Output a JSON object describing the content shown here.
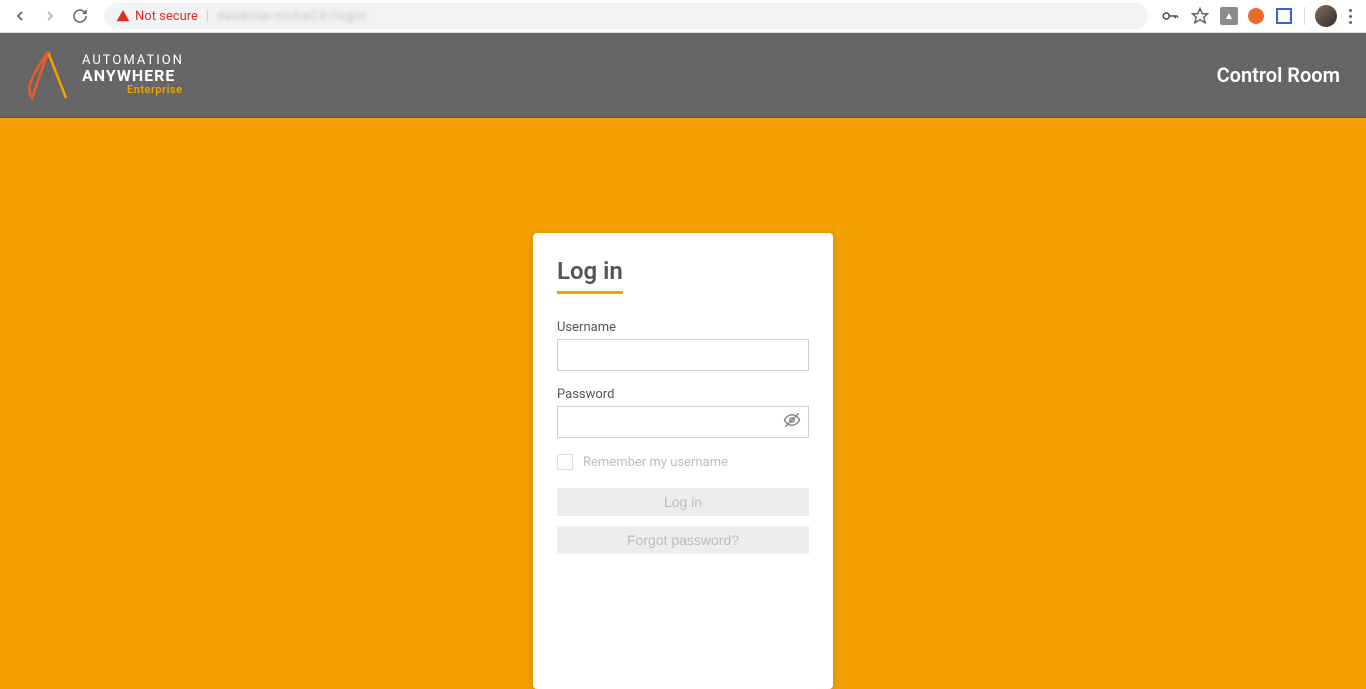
{
  "browser": {
    "security_label": "Not secure",
    "url_blurred": "desktop-noAaC#/login"
  },
  "header": {
    "brand_line1": "AUTOMATION",
    "brand_line2": "ANYWHERE",
    "brand_sub": "Enterprise",
    "title": "Control Room"
  },
  "login": {
    "title": "Log in",
    "username_label": "Username",
    "username_value": "",
    "password_label": "Password",
    "password_value": "",
    "remember_label": "Remember my username",
    "login_button": "Log in",
    "forgot_button": "Forgot password?"
  }
}
